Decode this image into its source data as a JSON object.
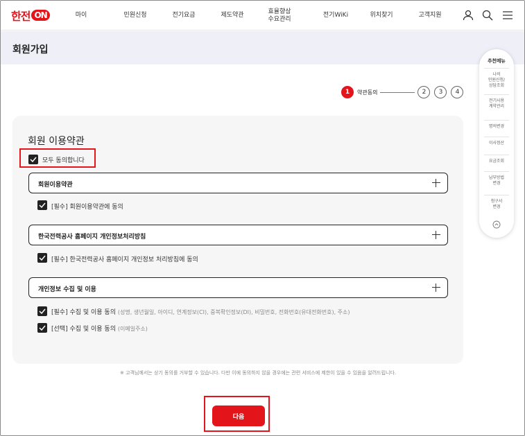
{
  "header": {
    "logo_hangul": "한전",
    "logo_on": "ON",
    "nav": [
      "마이",
      "민원신청",
      "전기요금",
      "제도약관",
      "효율향상\n수요관리",
      "전기WiKi",
      "위치찾기",
      "고객지원"
    ]
  },
  "page_title": "회원가입",
  "steps": {
    "active_number": "1",
    "active_label": "약관동의",
    "others": [
      "2",
      "3",
      "4"
    ]
  },
  "side_menu": {
    "title": "추천메뉴",
    "items": [
      "나의\n민원신청/\n상담조회",
      "전기사용\n계약관리",
      "명의변경",
      "이사정산",
      "요금조회",
      "납부방법\n변경",
      "청구서\n변경"
    ]
  },
  "terms": {
    "title": "회원 이용약관",
    "agree_all": "모두 동의합니다",
    "sections": [
      {
        "title": "회원이용약관",
        "items": [
          {
            "label": "[필수] 회원이용약관에 동의",
            "sub": ""
          }
        ]
      },
      {
        "title": "한국전력공사 홈페이지 개인정보처리방침",
        "items": [
          {
            "label": "[필수] 한국전력공사 홈페이지 개인정보 처리방침에 동의",
            "sub": ""
          }
        ]
      },
      {
        "title": "개인정보 수집 및 이용",
        "items": [
          {
            "label": "[필수] 수집 및 이용 동의",
            "sub": "(성명, 생년월일, 아이디, 연계정보(CI), 중복확인정보(DI), 비밀번호, 전화번호(유대전화번호), 주소)"
          },
          {
            "label": "[선택] 수집 및 이용 동의",
            "sub": "(이메일주소)"
          }
        ]
      }
    ]
  },
  "notice": "※ 고객님께서는 상기 동의를 거부할 수 있습니다. 다만 이에 동의하지 않을 경우에는 관련 서비스에 제한이 있을 수 있음을 알려드립니다.",
  "next_button": "다음"
}
